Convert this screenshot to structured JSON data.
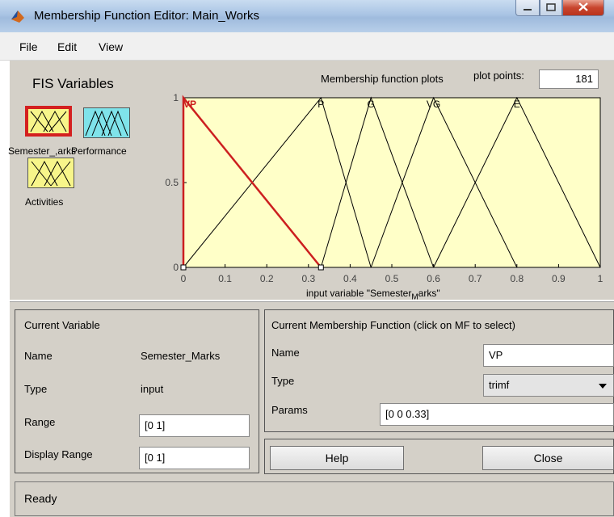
{
  "window": {
    "title": "Membership Function Editor: Main_Works"
  },
  "menu": [
    "File",
    "Edit",
    "View"
  ],
  "fis": {
    "title": "FIS Variables",
    "variables": [
      {
        "label": "Semester_Marks",
        "selected": true,
        "color": "#f7f58a"
      },
      {
        "label": "Performance",
        "selected": false,
        "color": "#7fe3ea"
      },
      {
        "label": "Activities",
        "selected": false,
        "color": "#f7f58a"
      }
    ],
    "overlap_label": "Semester_,arks"
  },
  "plot": {
    "title": "Membership function plots",
    "plot_points_label": "plot points:",
    "plot_points": "181",
    "xlabel": "input variable \"Semester_Marks\"",
    "xlabel_shown": "input variable \"Semester",
    "xlabel_tail": "arks\"",
    "xlabel_sub": "M",
    "xticks": [
      "0",
      "0.1",
      "0.2",
      "0.3",
      "0.4",
      "0.5",
      "0.6",
      "0.7",
      "0.8",
      "0.9",
      "1"
    ],
    "yticks": [
      "0",
      "0.5",
      "1"
    ],
    "background": "#ffffc8",
    "selected_color": "#cc1f1f"
  },
  "chart_data": {
    "type": "line",
    "xlim": [
      0,
      1
    ],
    "ylim": [
      0,
      1
    ],
    "series": [
      {
        "name": "VP",
        "x": [
          0,
          0,
          0.33
        ],
        "y": [
          0,
          1,
          0
        ],
        "selected": true
      },
      {
        "name": "P",
        "x": [
          0,
          0.33,
          0.45
        ],
        "y": [
          0,
          1,
          0
        ]
      },
      {
        "name": "G",
        "x": [
          0.33,
          0.45,
          0.6
        ],
        "y": [
          0,
          1,
          0
        ]
      },
      {
        "name": "VG",
        "x": [
          0.45,
          0.6,
          0.8
        ],
        "y": [
          0,
          1,
          0
        ]
      },
      {
        "name": "E",
        "x": [
          0.6,
          0.8,
          1
        ],
        "y": [
          0,
          1,
          0
        ]
      }
    ]
  },
  "current_variable": {
    "heading": "Current Variable",
    "name_label": "Name",
    "name_value": "Semester_Marks",
    "type_label": "Type",
    "type_value": "input",
    "range_label": "Range",
    "range_value": "[0 1]",
    "display_range_label": "Display Range",
    "display_range_value": "[0 1]"
  },
  "current_mf": {
    "heading": "Current Membership Function (click on MF to select)",
    "name_label": "Name",
    "name_value": "VP",
    "type_label": "Type",
    "type_value": "trimf",
    "params_label": "Params",
    "params_value": "[0 0 0.33]"
  },
  "buttons": {
    "help": "Help",
    "close": "Close"
  },
  "status": "Ready"
}
